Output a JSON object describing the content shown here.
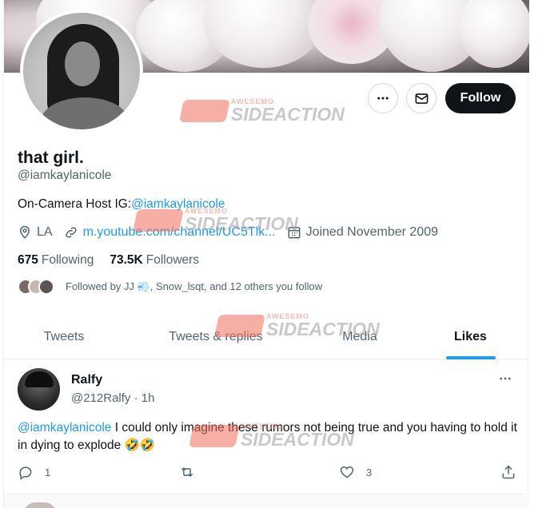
{
  "profile": {
    "display_name": "that girl.",
    "handle": "@iamkaylanicole",
    "bio_text": "On-Camera Host IG:",
    "bio_link": "@iamkaylanicole",
    "location": "LA",
    "website": "m.youtube.com/channel/UC5Tlk...",
    "joined": "Joined November 2009",
    "following_count": "675",
    "following_label": "Following",
    "followers_count": "73.5K",
    "followers_label": "Followers",
    "followed_by": "Followed by JJ 💨, Snow_lsqt, and 12 others you follow"
  },
  "actions": {
    "follow_label": "Follow"
  },
  "tabs": [
    {
      "label": "Tweets",
      "active": false
    },
    {
      "label": "Tweets & replies",
      "active": false
    },
    {
      "label": "Media",
      "active": false
    },
    {
      "label": "Likes",
      "active": true
    }
  ],
  "tweet": {
    "author_name": "Ralfy",
    "author_handle": "@212Ralfy · 1h",
    "mention": "@iamkaylanicole",
    "text": " I could only imagine these rumors not being true and you having to hold it in dying to explode 🤣🤣",
    "reply_count": "1",
    "like_count": "3"
  },
  "watermark": {
    "small": "AWESEMO",
    "big": "SIDEACTION"
  },
  "colors": {
    "accent": "#1d9bf0",
    "text_primary": "#0f1419",
    "text_secondary": "#536471",
    "watermark": "#f26d5b"
  },
  "icons": [
    "more-icon",
    "mail-icon",
    "location-icon",
    "link-icon",
    "calendar-icon",
    "reply-icon",
    "retweet-icon",
    "like-icon",
    "share-icon"
  ]
}
